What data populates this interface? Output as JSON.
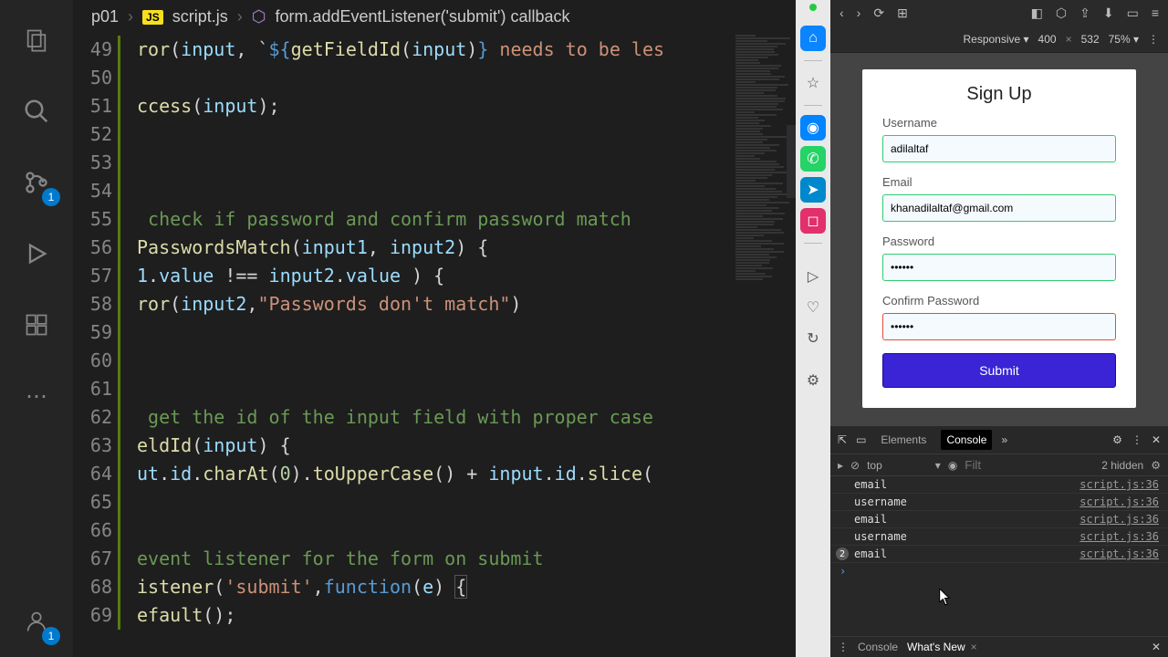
{
  "activity": {
    "scm_badge": "1",
    "account_badge": "1"
  },
  "breadcrumbs": {
    "root": "p01",
    "file": "script.js",
    "symbol": "form.addEventListener('submit') callback"
  },
  "code": {
    "lines_start": 49,
    "lines": [
      [
        [
          "fn",
          "ror"
        ],
        [
          "pun",
          "("
        ],
        [
          "var",
          "input"
        ],
        [
          "pun",
          ", `"
        ],
        [
          "kw",
          "${"
        ],
        [
          "fn",
          "getFieldId"
        ],
        [
          "pun",
          "("
        ],
        [
          "var",
          "input"
        ],
        [
          "pun",
          ")"
        ],
        [
          "kw",
          "}"
        ],
        [
          "str",
          " needs to be les"
        ]
      ],
      [],
      [
        [
          "fn",
          "ccess"
        ],
        [
          "pun",
          "("
        ],
        [
          "var",
          "input"
        ],
        [
          "pun",
          ");"
        ]
      ],
      [],
      [],
      [],
      [
        [
          "com",
          " check if password and confirm password match"
        ]
      ],
      [
        [
          "fn",
          "PasswordsMatch"
        ],
        [
          "pun",
          "("
        ],
        [
          "var",
          "input1"
        ],
        [
          "pun",
          ", "
        ],
        [
          "var",
          "input2"
        ],
        [
          "pun",
          ") {"
        ]
      ],
      [
        [
          "var",
          "1"
        ],
        [
          "pun",
          "."
        ],
        [
          "var",
          "value"
        ],
        [
          "pun",
          " !== "
        ],
        [
          "var",
          "input2"
        ],
        [
          "pun",
          "."
        ],
        [
          "var",
          "value"
        ],
        [
          "pun",
          " ) {"
        ]
      ],
      [
        [
          "fn",
          "ror"
        ],
        [
          "pun",
          "("
        ],
        [
          "var",
          "input2"
        ],
        [
          "pun",
          ","
        ],
        [
          "str",
          "\"Passwords don't match\""
        ],
        [
          "pun",
          ")"
        ]
      ],
      [],
      [],
      [],
      [
        [
          "com",
          " get the id of the input field with proper case"
        ]
      ],
      [
        [
          "fn",
          "eldId"
        ],
        [
          "pun",
          "("
        ],
        [
          "var",
          "input"
        ],
        [
          "pun",
          ") {"
        ]
      ],
      [
        [
          "var",
          "ut"
        ],
        [
          "pun",
          "."
        ],
        [
          "var",
          "id"
        ],
        [
          "pun",
          "."
        ],
        [
          "fn",
          "charAt"
        ],
        [
          "pun",
          "("
        ],
        [
          "num",
          "0"
        ],
        [
          "pun",
          ")."
        ],
        [
          "fn",
          "toUpperCase"
        ],
        [
          "pun",
          "() + "
        ],
        [
          "var",
          "input"
        ],
        [
          "pun",
          "."
        ],
        [
          "var",
          "id"
        ],
        [
          "pun",
          "."
        ],
        [
          "fn",
          "slice"
        ],
        [
          "pun",
          "("
        ]
      ],
      [],
      [],
      [
        [
          "com",
          "event listener for the form on submit"
        ]
      ],
      [
        [
          "fn",
          "istener"
        ],
        [
          "pun",
          "("
        ],
        [
          "str",
          "'submit'"
        ],
        [
          "pun",
          ","
        ],
        [
          "kw",
          "function"
        ],
        [
          "pun",
          "("
        ],
        [
          "var",
          "e"
        ],
        [
          "pun",
          ") "
        ],
        [
          "box",
          "{"
        ]
      ],
      [
        [
          "fn",
          "efault"
        ],
        [
          "pun",
          "();"
        ]
      ]
    ]
  },
  "device_bar": {
    "mode": "Responsive ▾",
    "width": "400",
    "height": "532",
    "zoom": "75% ▾"
  },
  "signup": {
    "title": "Sign Up",
    "username_label": "Username",
    "username_value": "adilaltaf",
    "email_label": "Email",
    "email_value": "khanadilaltaf@gmail.com",
    "password_label": "Password",
    "password_value": "••••••",
    "confirm_label": "Confirm Password",
    "confirm_value": "••••••",
    "submit_label": "Submit"
  },
  "devtools": {
    "tabs": {
      "elements": "Elements",
      "console": "Console"
    },
    "filter": {
      "context": "top",
      "placeholder": "Filt",
      "hidden": "2 hidden"
    },
    "rows": [
      {
        "msg": "email",
        "src": "script.js:36"
      },
      {
        "msg": "username",
        "src": "script.js:36"
      },
      {
        "msg": "email",
        "src": "script.js:36"
      },
      {
        "msg": "username",
        "src": "script.js:36"
      },
      {
        "msg": "email",
        "src": "script.js:36",
        "count": "2"
      }
    ],
    "drawer": {
      "console": "Console",
      "whatsnew": "What's New"
    }
  },
  "taskbar_icons": [
    {
      "name": "home-icon",
      "glyph": "⌂",
      "bg": "#0a84ff",
      "fg": "#fff"
    },
    {
      "name": "star-icon",
      "glyph": "☆",
      "fg": "#555"
    },
    {
      "name": "messenger-icon",
      "glyph": "◉",
      "bg": "#0084ff",
      "fg": "#fff"
    },
    {
      "name": "whatsapp-icon",
      "glyph": "✆",
      "bg": "#25d366",
      "fg": "#fff"
    },
    {
      "name": "telegram-icon",
      "glyph": "➤",
      "bg": "#0088cc",
      "fg": "#fff"
    },
    {
      "name": "instagram-icon",
      "glyph": "◻",
      "bg": "#e1306c",
      "fg": "#fff"
    },
    {
      "name": "send-icon",
      "glyph": "▷",
      "fg": "#555"
    },
    {
      "name": "heart-icon",
      "glyph": "♡",
      "fg": "#555"
    },
    {
      "name": "history-icon",
      "glyph": "↻",
      "fg": "#555"
    },
    {
      "name": "settings-icon",
      "glyph": "⚙",
      "fg": "#555"
    }
  ]
}
